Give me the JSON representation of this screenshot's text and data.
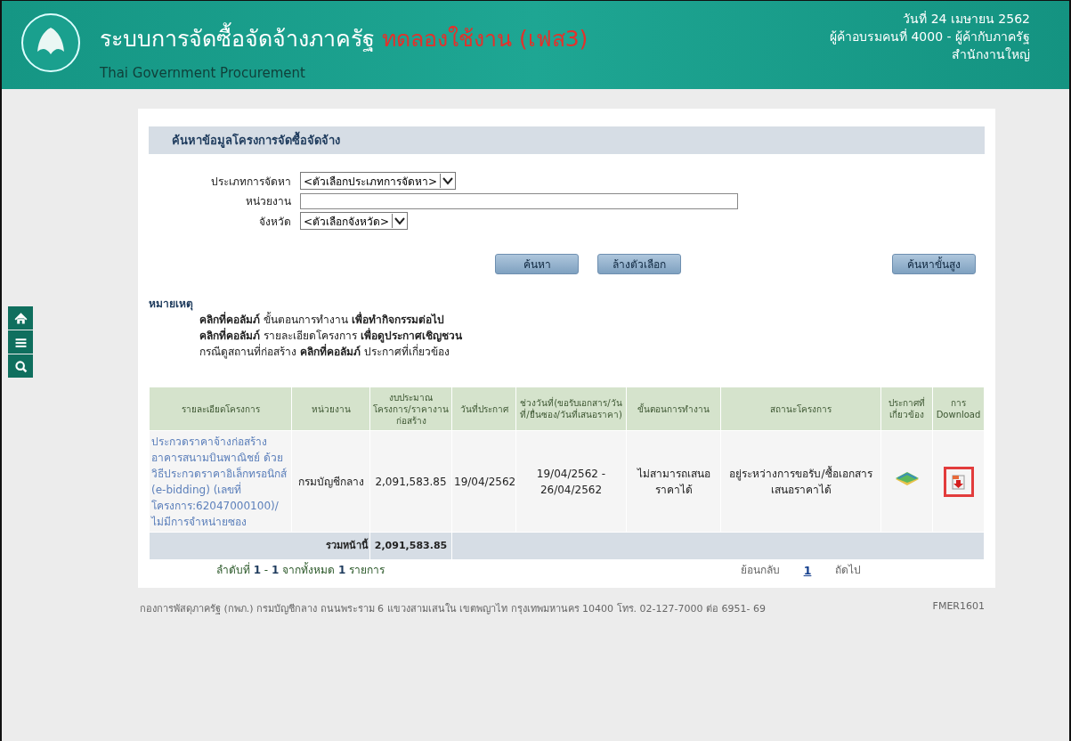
{
  "header": {
    "title": "ระบบการจัดซื้อจัดจ้างภาครัฐ",
    "title_suffix": "ทดลองใช้งาน (เฟส3)",
    "subtitle": "Thai Government Procurement",
    "date": "วันที่ 24 เมษายน 2562",
    "user": "ผู้ค้าอบรมคนที่ 4000 - ผู้ค้ากับภาครัฐ",
    "office": "สำนักงานใหญ่"
  },
  "side_nav": [
    {
      "kind": "home"
    },
    {
      "kind": "menu"
    },
    {
      "kind": "search"
    }
  ],
  "search_panel": {
    "heading": "ค้นหาข้อมูลโครงการจัดซื้อจัดจ้าง",
    "fields": [
      {
        "label": "ประเภทการจัดหา",
        "kind": "select",
        "value": "<ตัวเลือกประเภทการจัดหา>"
      },
      {
        "label": "หน่วยงาน",
        "kind": "text"
      },
      {
        "label": "จังหวัด",
        "kind": "select",
        "value": "<ตัวเลือกจังหวัด>"
      }
    ],
    "buttons": [
      "ค้นหา",
      "ล้างตัวเลือก"
    ],
    "advanced_button": "ค้นหาขั้นสูง"
  },
  "remarks": {
    "heading": "หมายเหตุ",
    "lines": [
      "**คลิกที่คอลัมภ์**  ขั้นตอนการทำงาน **เพื่อทำกิจกรรมต่อไป**",
      "**คลิกที่คอลัมภ์**  รายละเอียดโครงการ **เพื่อดูประกาศเชิญชวน**",
      "กรณีดูสถานที่ก่อสร้าง **คลิกที่คอลัมภ์** ประกาศที่เกี่ยวข้อง"
    ]
  },
  "table": {
    "columns": [
      "รายละเอียดโครงการ",
      "หน่วยงาน",
      "งบประมาณโครงการ/ราคางานก่อสร้าง",
      "วันที่ประกาศ",
      "ช่วงวันที่(ขอรับเอกสาร/วันที่/ยื่นซอง/วันที่เสนอราคา)",
      "ขั้นตอนการทำงาน",
      "สถานะโครงการ",
      "ประกาศที่เกี่ยวข้อง",
      "การ Download"
    ],
    "rows": [
      {
        "cells": [
          "ประกวดราคาจ้างก่อสร้างอาคารสนามบินพาณิชย์ ด้วยวิธีประกวดราคาอิเล็กทรอนิกส์ (e-bidding) (เลขที่โครงการ:62047000100)/ไม่มีการจำหน่ายซอง",
          "กรมบัญชีกลาง",
          "2,091,583.85",
          "19/04/2562",
          "19/04/2562 - 26/04/2562",
          "ไม่สามารถเสนอราคาได้",
          "อยู่ระหว่างการขอรับ/ซื้อเอกสารเสนอราคาได้"
        ],
        "download_highlighted": true
      }
    ],
    "total": {
      "label": "รวมหน้านี้",
      "value": "2,091,583.85"
    }
  },
  "pagination": {
    "summary": "ลำดับที่ **1** - **1** จากทั้งหมด **1** รายการ",
    "prev": "ย้อนกลับ",
    "pages": [
      {
        "label": "1",
        "selected": true
      }
    ],
    "next": "ถัดไป"
  },
  "footer": {
    "address": "กองการพัสดุภาครัฐ (กพภ.) กรมบัญชีกลาง ถนนพระราม 6 แขวงสามเสนใน เขตพญาไท กรุงเทพมหานคร 10400 โทร. 02-127-7000 ต่อ 6951- 69",
    "code": "FMER1601"
  }
}
